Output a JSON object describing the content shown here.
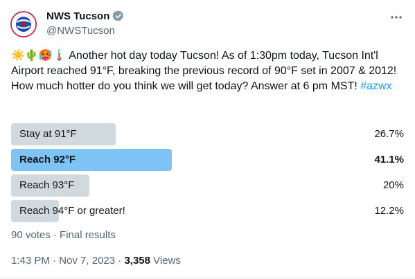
{
  "account": {
    "name": "NWS Tucson",
    "handle": "@NWSTucson",
    "verified": true,
    "avatar_icon": "nws-logo-icon"
  },
  "tweet": {
    "emojis": [
      "☀️",
      "🌵",
      "🥵",
      "🌡️"
    ],
    "text": "Another hot day today Tucson! As of 1:30pm today, Tucson Int'l Airport reached 91°F, breaking the previous record of 90°F set in 2007 & 2012! How much hotter do you think we will get today? Answer at 6 pm MST!",
    "hashtag": "#azwx"
  },
  "poll": {
    "options": [
      {
        "label": "Stay at 91°F",
        "percent": "26.7%",
        "value": 26.7,
        "winner": false
      },
      {
        "label": "Reach 92°F",
        "percent": "41.1%",
        "value": 41.1,
        "winner": true
      },
      {
        "label": "Reach 93°F",
        "percent": "20%",
        "value": 20,
        "winner": false
      },
      {
        "label": "Reach 94°F or greater!",
        "percent": "12.2%",
        "value": 12.2,
        "winner": false
      }
    ],
    "summary": "90 votes · Final results"
  },
  "meta": {
    "time": "1:43 PM",
    "date": "Nov 7, 2023",
    "separator": "·",
    "views_count": "3,358",
    "views_label": "Views"
  },
  "colors": {
    "accent": "#1d9bf0",
    "winner_bar": "#7dc3f6",
    "bar": "#cfd9de",
    "secondary_text": "#536471"
  }
}
